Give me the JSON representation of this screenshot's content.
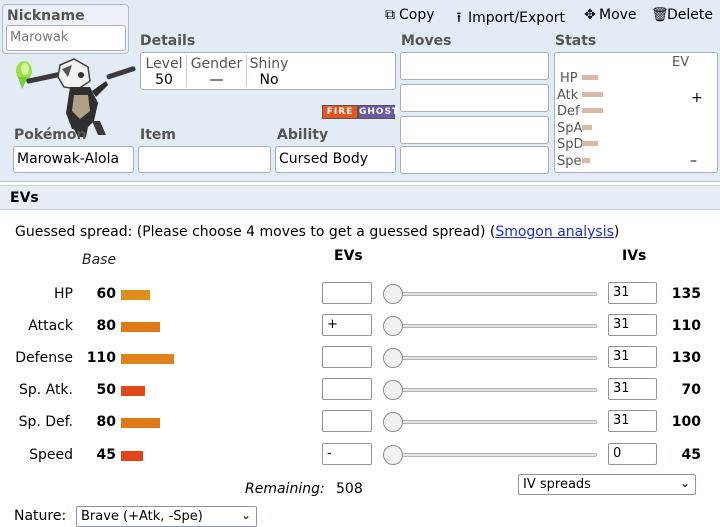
{
  "nickname": {
    "label": "Nickname",
    "placeholder": "Marowak"
  },
  "details": {
    "label": "Details",
    "level_label": "Level",
    "level": "50",
    "gender_label": "Gender",
    "gender": "—",
    "shiny_label": "Shiny",
    "shiny": "No"
  },
  "types": [
    {
      "name": "FIRE",
      "color": "#e8531f"
    },
    {
      "name": "GHOST",
      "color": "#6b5aa3"
    }
  ],
  "pokemon": {
    "label": "Pokémon",
    "value": "Marowak-Alola"
  },
  "item": {
    "label": "Item",
    "value": ""
  },
  "ability": {
    "label": "Ability",
    "value": "Cursed Body"
  },
  "moves": {
    "label": "Moves",
    "slots": [
      "",
      "",
      "",
      ""
    ]
  },
  "stats_panel": {
    "label": "Stats",
    "ev_label": "EV",
    "plus": "+",
    "minus": "–",
    "rows": [
      "HP",
      "Atk",
      "Def",
      "SpA",
      "SpD",
      "Spe"
    ]
  },
  "actions": {
    "copy": "Copy",
    "import_export": "Import/Export",
    "move": "Move",
    "delete": "Delete"
  },
  "evs_section": {
    "title": "EVs",
    "guessed_prefix": "Guessed spread: (Please choose 4 moves to get a guessed spread) (",
    "guessed_link": "Smogon analysis",
    "guessed_suffix": ")",
    "base_header": "Base",
    "evs_header": "EVs",
    "ivs_header": "IVs",
    "stats": [
      {
        "name": "HP",
        "base": "60",
        "ev": "",
        "iv": "31",
        "total": "135",
        "bar_color": "#e08d1c",
        "base_num": 60
      },
      {
        "name": "Attack",
        "base": "80",
        "ev": "+",
        "iv": "31",
        "total": "110",
        "bar_color": "#e07818",
        "base_num": 80
      },
      {
        "name": "Defense",
        "base": "110",
        "ev": "",
        "iv": "31",
        "total": "130",
        "bar_color": "#e0831a",
        "base_num": 110
      },
      {
        "name": "Sp. Atk.",
        "base": "50",
        "ev": "",
        "iv": "31",
        "total": "70",
        "bar_color": "#e04a18",
        "base_num": 50
      },
      {
        "name": "Sp. Def.",
        "base": "80",
        "ev": "",
        "iv": "31",
        "total": "100",
        "bar_color": "#e07818",
        "base_num": 80
      },
      {
        "name": "Speed",
        "base": "45",
        "ev": "-",
        "iv": "0",
        "total": "45",
        "bar_color": "#e04418",
        "base_num": 45
      }
    ],
    "remaining_label": "Remaining:",
    "remaining_value": "508",
    "iv_spreads": "IV spreads",
    "nature_label": "Nature:",
    "nature_value": "Brave (+Atk, -Spe)"
  }
}
